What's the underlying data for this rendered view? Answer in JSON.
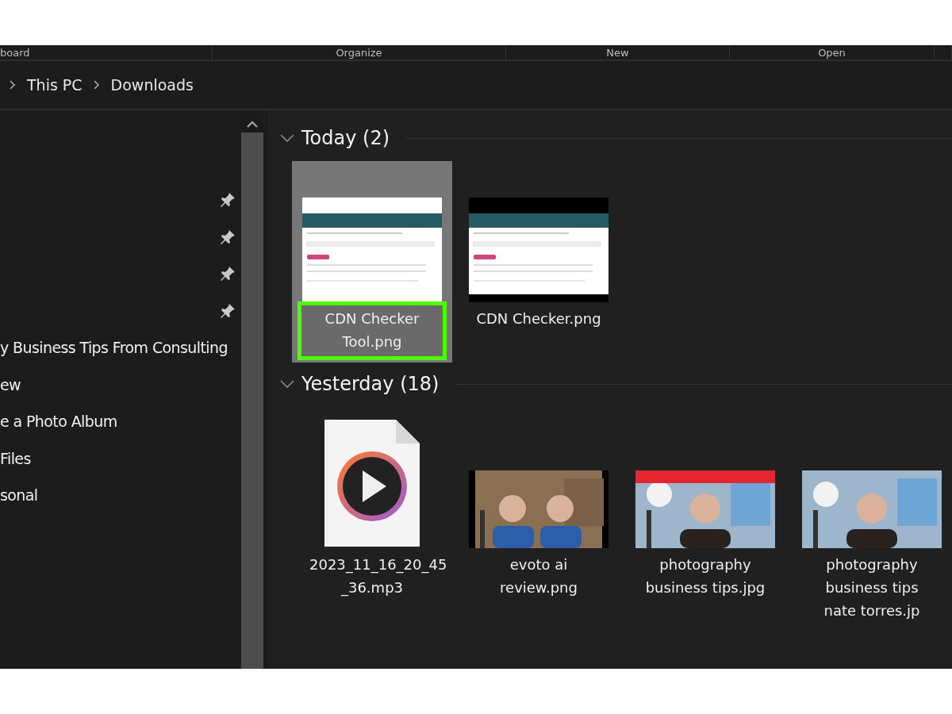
{
  "ribbon": {
    "groups": [
      "board",
      "Organize",
      "New",
      "Open"
    ]
  },
  "address_bar": {
    "crumbs": [
      "This PC",
      "Downloads"
    ]
  },
  "sidebar": {
    "items": [
      {
        "pinned": true
      },
      {
        "pinned": true
      },
      {
        "pinned": true
      },
      {
        "pinned": true
      },
      {
        "label": "y Business Tips From Consulting",
        "pinned": false
      },
      {
        "label": "ew",
        "pinned": false
      },
      {
        "label": "e a Photo Album",
        "pinned": false
      },
      {
        "label": " Files",
        "pinned": false
      },
      {
        "label": "sonal",
        "pinned": false
      }
    ]
  },
  "groups": [
    {
      "title": "Today (2)",
      "expanded": true,
      "items": [
        {
          "name": "CDN Checker Tool.png",
          "kind": "screenshot",
          "selected": true,
          "highlighted": true
        },
        {
          "name": "CDN Checker.png",
          "kind": "screenshot",
          "selected": false,
          "highlighted": false
        }
      ]
    },
    {
      "title": "Yesterday (18)",
      "expanded": true,
      "items": [
        {
          "name": "2023_11_16_20_45 _36.mp3",
          "kind": "audio",
          "selected": false,
          "highlighted": false
        },
        {
          "name": "evoto ai review.png",
          "selected": false,
          "highlighted": false
        },
        {
          "name": "photography business tips.jpg",
          "selected": false,
          "highlighted": false
        },
        {
          "name": "photography business tips nate torres.jp",
          "selected": false,
          "highlighted": false
        }
      ]
    }
  ]
}
